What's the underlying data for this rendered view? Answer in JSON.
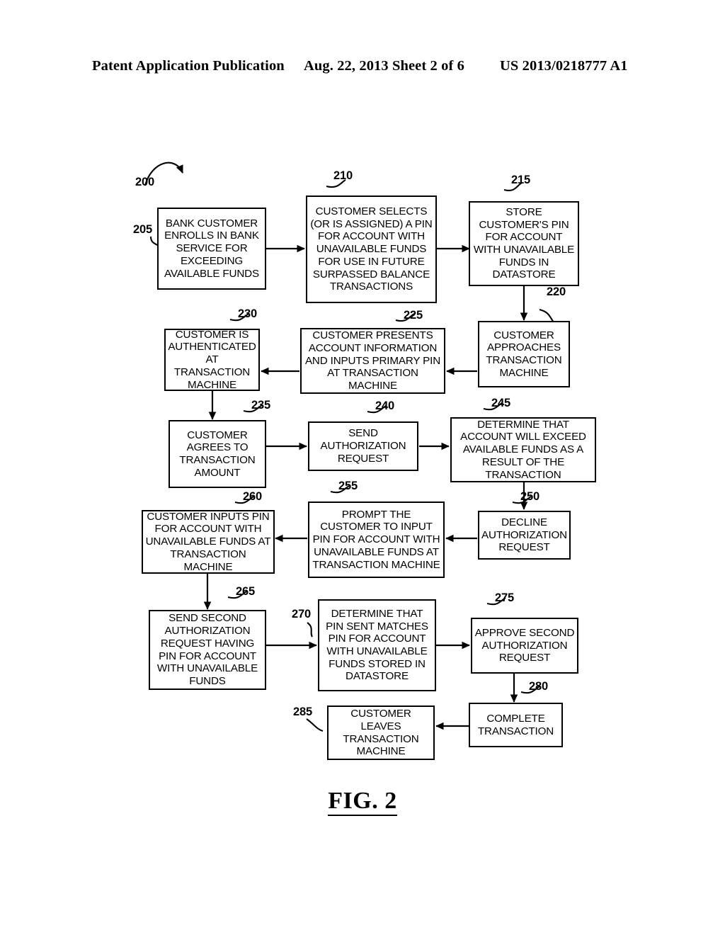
{
  "header": {
    "publication": "Patent Application Publication",
    "date_sheet": "Aug. 22, 2013  Sheet 2 of 6",
    "publication_number": "US 2013/0218777 A1"
  },
  "figure": {
    "caption": "FIG. 2",
    "diagram_ref": "200",
    "nodes": [
      {
        "ref": "205",
        "text": "BANK CUSTOMER ENROLLS IN BANK SERVICE FOR EXCEEDING AVAILABLE FUNDS"
      },
      {
        "ref": "210",
        "text": "CUSTOMER SELECTS (OR IS ASSIGNED) A PIN FOR ACCOUNT WITH UNAVAILABLE FUNDS FOR USE IN FUTURE SURPASSED BALANCE TRANSACTIONS"
      },
      {
        "ref": "215",
        "text": "STORE CUSTOMER'S PIN FOR ACCOUNT WITH UNAVAILABLE FUNDS IN DATASTORE"
      },
      {
        "ref": "220",
        "text": "CUSTOMER APPROACHES TRANSACTION MACHINE"
      },
      {
        "ref": "225",
        "text": "CUSTOMER PRESENTS ACCOUNT INFORMATION AND INPUTS PRIMARY PIN AT TRANSACTION MACHINE"
      },
      {
        "ref": "230",
        "text": "CUSTOMER IS AUTHENTICATED AT TRANSACTION MACHINE"
      },
      {
        "ref": "235",
        "text": "CUSTOMER AGREES TO TRANSACTION AMOUNT"
      },
      {
        "ref": "240",
        "text": "SEND AUTHORIZATION REQUEST"
      },
      {
        "ref": "245",
        "text": "DETERMINE THAT ACCOUNT WILL EXCEED AVAILABLE FUNDS AS A RESULT OF THE TRANSACTION"
      },
      {
        "ref": "250",
        "text": "DECLINE AUTHORIZATION REQUEST"
      },
      {
        "ref": "255",
        "text": "PROMPT THE CUSTOMER TO INPUT PIN FOR ACCOUNT WITH UNAVAILABLE FUNDS AT TRANSACTION MACHINE"
      },
      {
        "ref": "260",
        "text": "CUSTOMER INPUTS PIN FOR ACCOUNT WITH UNAVAILABLE FUNDS AT TRANSACTION MACHINE"
      },
      {
        "ref": "265",
        "text": "SEND SECOND AUTHORIZATION REQUEST HAVING PIN FOR ACCOUNT WITH UNAVAILABLE FUNDS"
      },
      {
        "ref": "270",
        "text": "DETERMINE THAT PIN SENT MATCHES PIN FOR ACCOUNT WITH UNAVAILABLE FUNDS STORED IN DATASTORE"
      },
      {
        "ref": "275",
        "text": "APPROVE SECOND AUTHORIZATION REQUEST"
      },
      {
        "ref": "280",
        "text": "COMPLETE TRANSACTION"
      },
      {
        "ref": "285",
        "text": "CUSTOMER LEAVES TRANSACTION MACHINE"
      }
    ]
  }
}
